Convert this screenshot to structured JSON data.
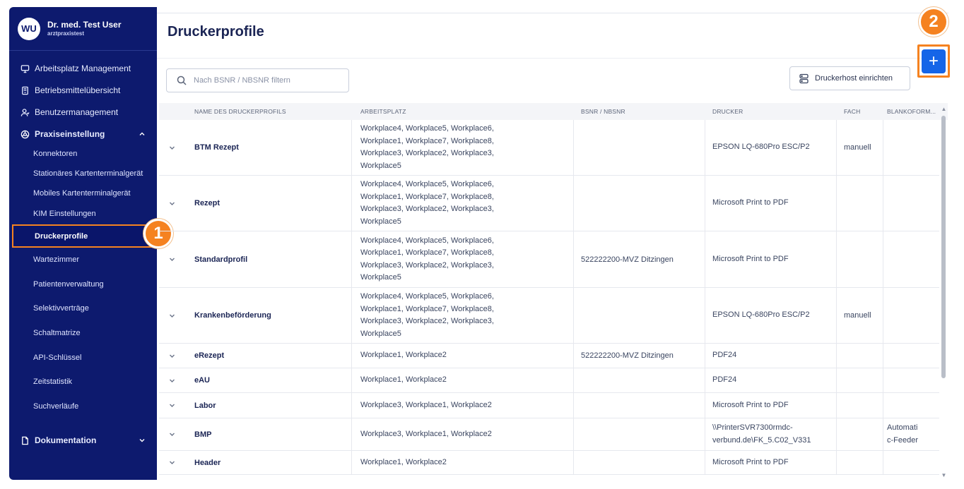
{
  "user": {
    "initials": "WU",
    "name": "Dr. med. Test User",
    "subtitle": "arztpraxistest"
  },
  "sidebar": {
    "top_items": [
      {
        "label": "Arbeitsplatz Management",
        "icon": "monitor-icon"
      },
      {
        "label": "Betriebsmittelübersicht",
        "icon": "device-icon"
      },
      {
        "label": "Benutzermanagement",
        "icon": "users-icon"
      }
    ],
    "section": {
      "label": "Praxiseinstellung",
      "icon": "settings-icon",
      "expanded": true
    },
    "sub_items": [
      "Konnektoren",
      "Stationäres Kartenterminalgerät",
      "Mobiles Kartenterminalgerät",
      "KIM Einstellungen",
      "Druckerprofile",
      "Wartezimmer",
      "Patientenverwaltung",
      "Selektivverträge",
      "Schaltmatrize",
      "API-Schlüssel",
      "Zeitstatistik",
      "Suchverläufe"
    ],
    "active_sub": "Druckerprofile",
    "doc_section": {
      "label": "Dokumentation",
      "icon": "document-icon",
      "expanded": false
    }
  },
  "callouts": {
    "one": "1",
    "two": "2"
  },
  "page": {
    "title": "Druckerprofile"
  },
  "search": {
    "placeholder": "Nach BSNR / NBSNR filtern"
  },
  "actions": {
    "printer_host_label": "Druckerhost einrichten",
    "add_label": "+"
  },
  "table": {
    "headers": [
      "NAME DES DRUCKERPROFILS",
      "ARBEITSPLATZ",
      "BSNR / NBSNR",
      "DRUCKER",
      "FACH",
      "BLANKOFORM..."
    ],
    "rows": [
      {
        "name": "BTM Rezept",
        "workplaces": [
          "Workplace4, Workplace5, Workplace6,",
          "Workplace1, Workplace7, Workplace8,",
          "Workplace3, Workplace2, Workplace3,",
          "Workplace5"
        ],
        "bsnr": "",
        "printer": [
          "EPSON LQ-680Pro ESC/P2"
        ],
        "fach": "manuell",
        "blank": []
      },
      {
        "name": "Rezept",
        "workplaces": [
          "Workplace4, Workplace5, Workplace6,",
          "Workplace1, Workplace7, Workplace8,",
          "Workplace3, Workplace2, Workplace3,",
          "Workplace5"
        ],
        "bsnr": "",
        "printer": [
          "Microsoft Print to PDF"
        ],
        "fach": "",
        "blank": []
      },
      {
        "name": "Standardprofil",
        "workplaces": [
          "Workplace4, Workplace5, Workplace6,",
          "Workplace1, Workplace7, Workplace8,",
          "Workplace3, Workplace2, Workplace3,",
          "Workplace5"
        ],
        "bsnr": "522222200-MVZ Ditzingen",
        "printer": [
          "Microsoft Print to PDF"
        ],
        "fach": "",
        "blank": []
      },
      {
        "name": "Krankenbeförderung",
        "workplaces": [
          "Workplace4, Workplace5, Workplace6,",
          "Workplace1, Workplace7, Workplace8,",
          "Workplace3, Workplace2, Workplace3,",
          "Workplace5"
        ],
        "bsnr": "",
        "printer": [
          "EPSON LQ-680Pro ESC/P2"
        ],
        "fach": "manuell",
        "blank": []
      },
      {
        "name": "eRezept",
        "workplaces": [
          "Workplace1, Workplace2"
        ],
        "bsnr": "522222200-MVZ Ditzingen",
        "printer": [
          "PDF24"
        ],
        "fach": "",
        "blank": []
      },
      {
        "name": "eAU",
        "workplaces": [
          "Workplace1, Workplace2"
        ],
        "bsnr": "",
        "printer": [
          "PDF24"
        ],
        "fach": "",
        "blank": []
      },
      {
        "name": "Labor",
        "workplaces": [
          "Workplace3, Workplace1, Workplace2"
        ],
        "bsnr": "",
        "printer": [
          "Microsoft Print to PDF"
        ],
        "fach": "",
        "blank": []
      },
      {
        "name": "BMP",
        "workplaces": [
          "Workplace3, Workplace1, Workplace2"
        ],
        "bsnr": "",
        "printer": [
          "\\\\PrinterSVR7300rmdc-",
          "verbund.de\\FK_5.C02_V331"
        ],
        "fach": "",
        "blank": [
          "Automati",
          "c-Feeder"
        ]
      },
      {
        "name": "Header",
        "workplaces": [
          "Workplace1, Workplace2"
        ],
        "bsnr": "",
        "printer": [
          "Microsoft Print to PDF"
        ],
        "fach": "",
        "blank": []
      }
    ]
  },
  "colors": {
    "sidebar": "#0d1a6e",
    "accent": "#f58220",
    "primary_button": "#1565e8"
  }
}
